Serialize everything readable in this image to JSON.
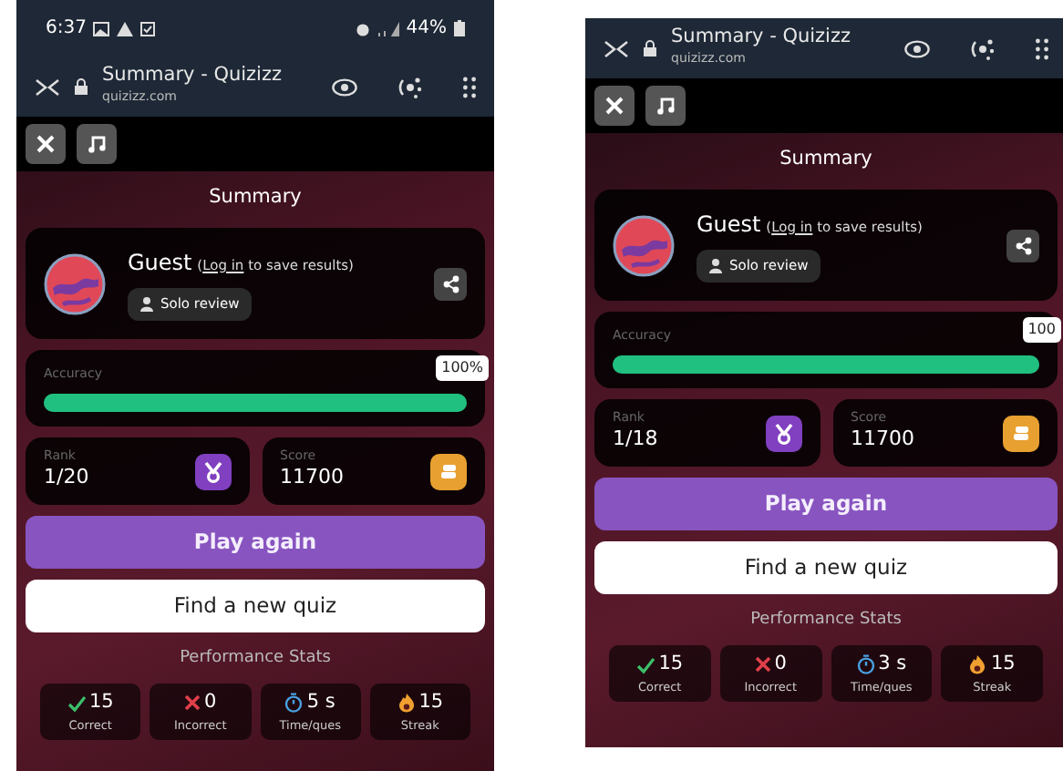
{
  "screens": [
    {
      "status_bar": {
        "time": "6:37",
        "battery": "44%"
      },
      "browser_bar": {
        "title": "Summary - Quizizz",
        "url": "quizizz.com"
      },
      "heading": "Summary",
      "player": {
        "name": "Guest",
        "note_before": "(",
        "login_link": "Log in",
        "note_after": " to save results)",
        "mode": "Solo review"
      },
      "accuracy": {
        "label": "Accuracy",
        "level": 1,
        "reading": "100%"
      },
      "rank": {
        "label": "Rank",
        "value": "1/20"
      },
      "score": {
        "label": "Score",
        "value": "11700"
      },
      "buttons": [
        {
          "label": "Play again",
          "kind": "primary"
        },
        {
          "label": "Find a new quiz",
          "kind": "light"
        }
      ],
      "stats_heading": "Performance Stats",
      "stats": [
        {
          "kind": "correct",
          "value": "15",
          "label": "Correct"
        },
        {
          "kind": "incorrect",
          "value": "0",
          "label": "Incorrect"
        },
        {
          "kind": "time",
          "value": "5 s",
          "label": "Time/ques"
        },
        {
          "kind": "streak",
          "value": "15",
          "label": "Streak"
        }
      ]
    },
    {
      "browser_bar": {
        "title": "Summary - Quizizz",
        "url": "quizizz.com"
      },
      "heading": "Summary",
      "player": {
        "name": "Guest",
        "note_before": "(",
        "login_link": "Log in",
        "note_after": " to save results)",
        "mode": "Solo review"
      },
      "accuracy": {
        "label": "Accuracy",
        "level": 1,
        "reading": "100"
      },
      "rank": {
        "label": "Rank",
        "value": "1/18"
      },
      "score": {
        "label": "Score",
        "value": "11700"
      },
      "buttons": [
        {
          "label": "Play again",
          "kind": "primary"
        },
        {
          "label": "Find a new quiz",
          "kind": "light"
        }
      ],
      "stats_heading": "Performance Stats",
      "stats": [
        {
          "kind": "correct",
          "value": "15",
          "label": "Correct"
        },
        {
          "kind": "incorrect",
          "value": "0",
          "label": "Incorrect"
        },
        {
          "kind": "time",
          "value": "3 s",
          "label": "Time/ques"
        },
        {
          "kind": "streak",
          "value": "15",
          "label": "Streak"
        }
      ]
    }
  ]
}
